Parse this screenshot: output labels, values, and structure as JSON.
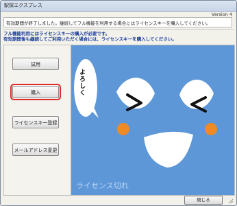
{
  "window": {
    "title": "駅探エクスプレス",
    "version": "Version 4"
  },
  "notice": "有効期間が終了しました。継続してフル機能を利用する場合にはライセンスキーを購入してください。",
  "info_lines": [
    "フル機能利用にはライセンスキーの購入が必要です。",
    "有効期間後も継続してご利用いただく場合には、ライセンスキーを購入してください。"
  ],
  "buttons": {
    "trial": "試用",
    "purchase": "購入",
    "license_register": "ライセンスキー登録",
    "email_change": "メールアドレス変更",
    "close": "閉じる"
  },
  "illustration": {
    "bubble_text": "よろしく",
    "caption": "ライセンス切れ",
    "bg_color": "#5d97d8",
    "cheek_color": "#f08a24"
  }
}
